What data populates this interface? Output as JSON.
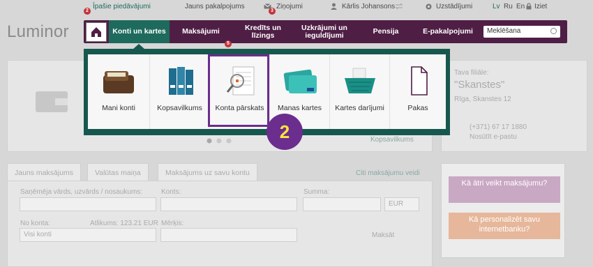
{
  "topbar": {
    "personal_offers": "Īpašie piedāvājumi",
    "personal_offers_badge": "2",
    "new_services": "Jauns pakalpojums",
    "notices": "Ziņojumi",
    "notices_badge": "3",
    "user": "Kārlis Johansons",
    "settings": "Uzstādījumi",
    "lang_lv": "Lv",
    "lang_ru": "Ru",
    "lang_en": "En",
    "logout": "Iziet"
  },
  "logo": "Luminor",
  "nav": {
    "items": [
      {
        "label": "Konti un kartes"
      },
      {
        "label": "Maksājumi"
      },
      {
        "label": "Kredīts un līzings"
      },
      {
        "label": "Uzkrājumi un ieguldījumi"
      },
      {
        "label": "Pensija"
      },
      {
        "label": "E-pakalpojumi"
      }
    ],
    "search_placeholder": "Meklēšana",
    "payments_badge": "5"
  },
  "popup": {
    "items": [
      {
        "label": "Mani konti",
        "icon": "wallet-icon"
      },
      {
        "label": "Kopsavilkums",
        "icon": "binders-icon"
      },
      {
        "label": "Konta pārskats",
        "icon": "statement-magnifier-icon"
      },
      {
        "label": "Manas kartes",
        "icon": "cards-icon"
      },
      {
        "label": "Kartes darījumi",
        "icon": "basket-icon"
      },
      {
        "label": "Pakas",
        "icon": "document-icon"
      }
    ]
  },
  "step_number": "2",
  "summary_link": "Kopsavilkums",
  "branch": {
    "heading": "Tava filiāle:",
    "name": "\"Skanstes\"",
    "address": "Rīga, Skanstes 12",
    "phone": "(+371) 67 17 1880",
    "email_link": "Nosūtīt e-pastu"
  },
  "payment": {
    "tabs": [
      "Jauns maksājums",
      "Valūtas maiņa",
      "Maksājums uz savu kontu"
    ],
    "other_link": "Citi maksājumu veidi",
    "recipient_label": "Saņēmēja vārds, uzvārds / nosaukums:",
    "account_label": "Konts:",
    "amount_label": "Summa:",
    "currency": "EUR",
    "from_label": "No konta:",
    "balance": "Atlikums: 123.21 EUR",
    "purpose_label": "Mērķis:",
    "from_value": "Visi konti",
    "pay_button": "Maksāt"
  },
  "bubbles": {
    "fast_payment": "Kā ātri veikt maksājumu?",
    "personalize": "Kā personalizēt savu internetbanku?"
  },
  "colors": {
    "nav_bg": "#4f1e45",
    "nav_active": "#1e6a5c",
    "popup_border": "#17584e",
    "highlight": "#6b2d8e",
    "step_text": "#ffe33a"
  }
}
